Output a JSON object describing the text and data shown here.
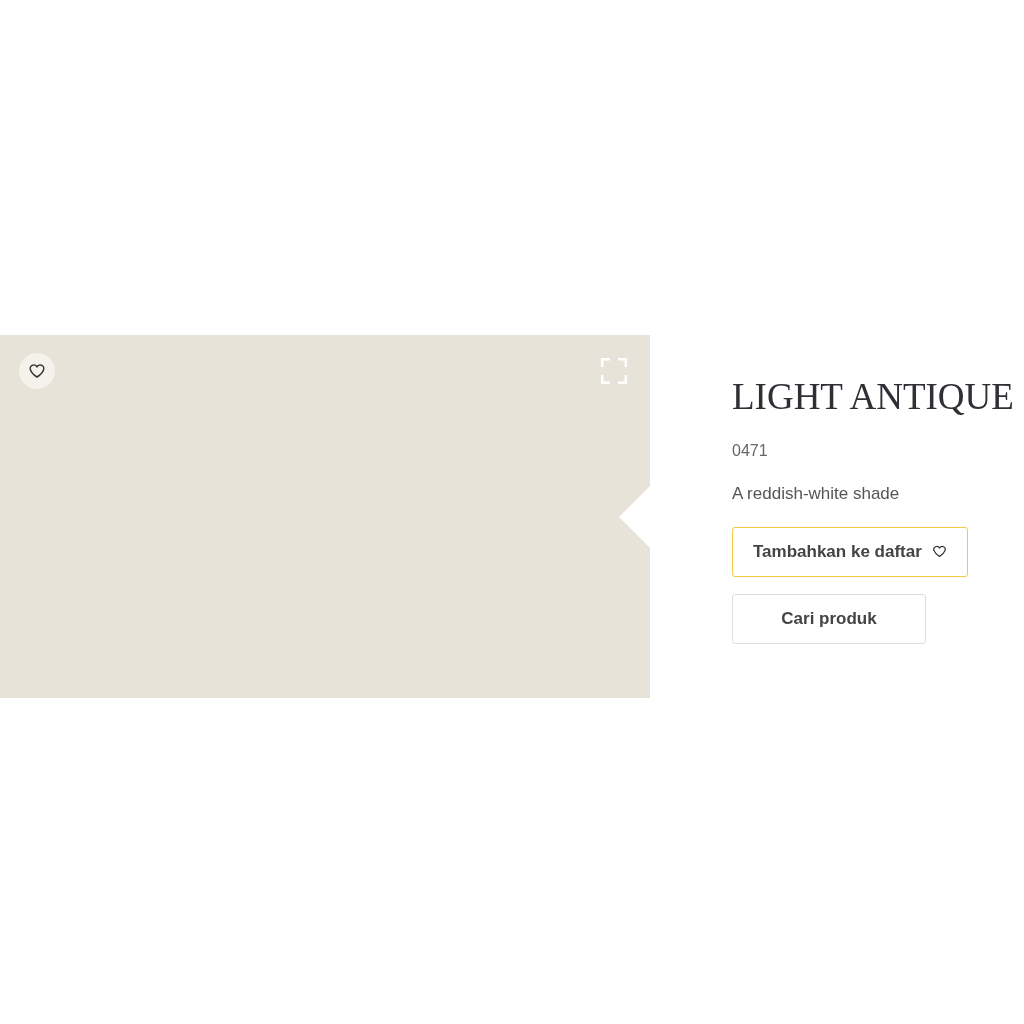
{
  "swatch": {
    "color": "#e8e3d9"
  },
  "product": {
    "title": "LIGHT ANTIQUE",
    "code": "0471",
    "description": "A reddish-white shade"
  },
  "buttons": [
    {
      "label": "Tambahkan ke daftar",
      "kind": "favorite"
    },
    {
      "label": "Cari produk",
      "kind": "plain"
    }
  ]
}
